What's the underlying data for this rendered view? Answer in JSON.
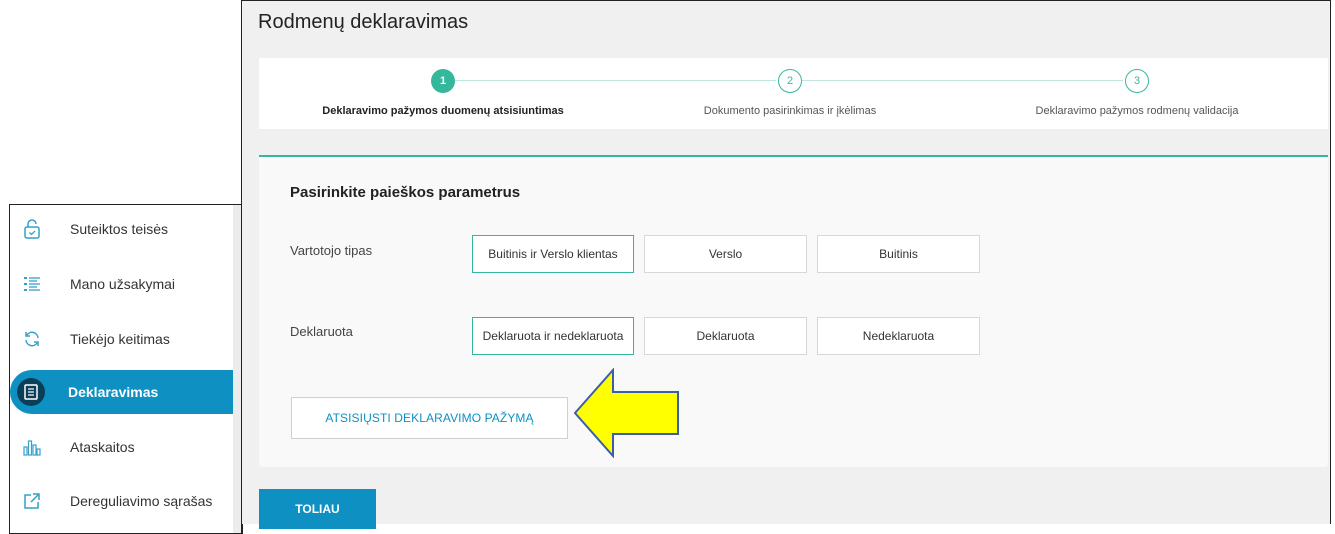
{
  "sidebar": {
    "items": [
      {
        "label": "Suteiktos teisės",
        "icon": "lock-icon",
        "active": false
      },
      {
        "label": "Mano užsakymai",
        "icon": "list-icon",
        "active": false
      },
      {
        "label": "Tiekėjo keitimas",
        "icon": "refresh-icon",
        "active": false
      },
      {
        "label": "Deklaravimas",
        "icon": "document-icon",
        "active": true
      },
      {
        "label": "Ataskaitos",
        "icon": "bar-chart-icon",
        "active": false
      },
      {
        "label": "Dereguliavimo sąrašas",
        "icon": "external-link-icon",
        "active": false
      }
    ]
  },
  "page": {
    "title": "Rodmenų deklaravimas"
  },
  "stepper": {
    "steps": [
      {
        "number": "1",
        "label": "Deklaravimo pažymos duomenų atsisiuntimas",
        "state": "current"
      },
      {
        "number": "2",
        "label": "Dokumento pasirinkimas ir įkėlimas",
        "state": "todo"
      },
      {
        "number": "3",
        "label": "Deklaravimo pažymos rodmenų validacija",
        "state": "todo"
      }
    ]
  },
  "form": {
    "title": "Pasirinkite paieškos parametrus",
    "consumer_type": {
      "label": "Vartotojo tipas",
      "options": [
        "Buitinis ir Verslo klientas",
        "Verslo",
        "Buitinis"
      ],
      "selected": "Buitinis ir Verslo klientas"
    },
    "declared": {
      "label": "Deklaruota",
      "options": [
        "Deklaruota ir nedeklaruota",
        "Deklaruota",
        "Nedeklaruota"
      ],
      "selected": "Deklaruota ir nedeklaruota"
    },
    "download_label": "ATSISIŲSTI DEKLARAVIMO PAŽYMĄ"
  },
  "next_label": "TOLIAU",
  "colors": {
    "accent": "#0e90c3",
    "teal": "#35b79c",
    "arrow_fill": "#ffff00",
    "arrow_stroke": "#3a5fa8"
  }
}
